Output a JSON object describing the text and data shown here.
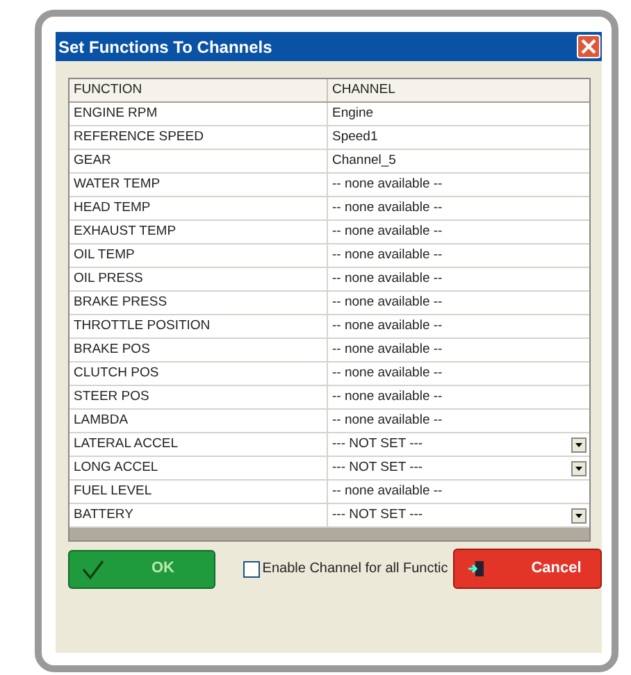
{
  "window": {
    "title": "Set Functions To Channels"
  },
  "table": {
    "columns": [
      "FUNCTION",
      "CHANNEL"
    ],
    "rows": [
      {
        "function": "ENGINE RPM",
        "channel": "Engine",
        "kind": "text"
      },
      {
        "function": "REFERENCE SPEED",
        "channel": "Speed1",
        "kind": "text"
      },
      {
        "function": "GEAR",
        "channel": "Channel_5",
        "kind": "text"
      },
      {
        "function": "WATER TEMP",
        "channel": "-- none available --",
        "kind": "text"
      },
      {
        "function": "HEAD TEMP",
        "channel": "-- none available --",
        "kind": "text"
      },
      {
        "function": "EXHAUST TEMP",
        "channel": "-- none available --",
        "kind": "text"
      },
      {
        "function": "OIL TEMP",
        "channel": "-- none available --",
        "kind": "text"
      },
      {
        "function": "OIL  PRESS",
        "channel": "-- none available --",
        "kind": "text"
      },
      {
        "function": "BRAKE PRESS",
        "channel": "-- none available --",
        "kind": "text"
      },
      {
        "function": "THROTTLE POSITION",
        "channel": "-- none available --",
        "kind": "text"
      },
      {
        "function": "BRAKE POS",
        "channel": "-- none available --",
        "kind": "text"
      },
      {
        "function": "CLUTCH  POS",
        "channel": "-- none available --",
        "kind": "text"
      },
      {
        "function": "STEER POS",
        "channel": "-- none available --",
        "kind": "text"
      },
      {
        "function": "LAMBDA",
        "channel": "-- none available --",
        "kind": "text"
      },
      {
        "function": "LATERAL  ACCEL",
        "channel": "--- NOT SET ---",
        "kind": "dropdown"
      },
      {
        "function": "LONG ACCEL",
        "channel": "--- NOT SET ---",
        "kind": "dropdown"
      },
      {
        "function": "FUEL LEVEL",
        "channel": "-- none available --",
        "kind": "text"
      },
      {
        "function": "BATTERY",
        "channel": "--- NOT SET ---",
        "kind": "dropdown"
      }
    ]
  },
  "ok_button": "OK",
  "enable_all": {
    "label": "Enable Channel for all Functic",
    "checked": false
  },
  "cancel_button": "Cancel"
}
